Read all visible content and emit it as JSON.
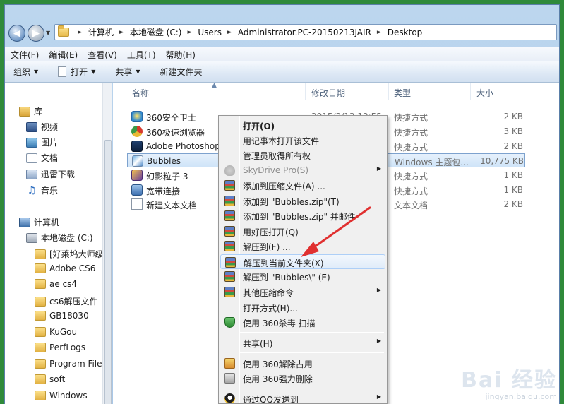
{
  "address": {
    "crumbs": [
      "计算机",
      "本地磁盘 (C:)",
      "Users",
      "Administrator.PC-20150213JAIR",
      "Desktop"
    ]
  },
  "menubar": [
    "文件(F)",
    "编辑(E)",
    "查看(V)",
    "工具(T)",
    "帮助(H)"
  ],
  "toolbar": {
    "organize": "组织",
    "open": "打开",
    "share": "共享",
    "new_folder": "新建文件夹"
  },
  "nav": {
    "libraries": "库",
    "videos": "视频",
    "pictures": "图片",
    "documents": "文档",
    "downloads": "迅雷下载",
    "music": "音乐",
    "computer": "计算机",
    "drive": "本地磁盘 (C:)",
    "folders": [
      "[好莱坞大师级",
      "Adobe CS6",
      "ae cs4",
      "cs6解压文件",
      "GB18030",
      "KuGou",
      "PerfLogs",
      "Program Files",
      "soft",
      "Windows"
    ]
  },
  "columns": {
    "name": "名称",
    "date": "修改日期",
    "type": "类型",
    "size": "大小"
  },
  "files": [
    {
      "name": "360安全卫士",
      "date": "2015/2/13 13:55",
      "type": "快捷方式",
      "size": "2 KB"
    },
    {
      "name": "360极速浏览器",
      "date": "",
      "type": "快捷方式",
      "size": "3 KB"
    },
    {
      "name": "Adobe Photoshop C",
      "date": "",
      "type": "快捷方式",
      "size": "2 KB"
    },
    {
      "name": "Bubbles",
      "date": "",
      "type": "Windows 主题包...",
      "size": "10,775 KB"
    },
    {
      "name": "幻影粒子 3",
      "date": "",
      "type": "快捷方式",
      "size": "1 KB"
    },
    {
      "name": "宽带连接",
      "date": "",
      "type": "快捷方式",
      "size": "1 KB"
    },
    {
      "name": "新建文本文档",
      "date": "",
      "type": "文本文档",
      "size": "2 KB"
    }
  ],
  "context_menu": {
    "open": "打开(O)",
    "open_notepad": "用记事本打开该文件",
    "take_ownership": "管理员取得所有权",
    "skydrive": "SkyDrive Pro(S)",
    "add_archive": "添加到压缩文件(A) ...",
    "add_zip": "添加到 \"Bubbles.zip\"(T)",
    "add_zip_mail": "添加到 \"Bubbles.zip\" 并邮件",
    "open_haozip": "用好压打开(Q)",
    "extract_to": "解压到(F) ...",
    "extract_here": "解压到当前文件夹(X)",
    "extract_folder": "解压到 \"Bubbles\\\" (E)",
    "more_commands": "其他压缩命令",
    "open_with": "打开方式(H)...",
    "scan_360": "使用 360杀毒 扫描",
    "share": "共享(H)",
    "unlock_360": "使用 360解除占用",
    "force_delete_360": "使用 360强力删除",
    "send_qq": "通过QQ发送到"
  },
  "watermark": {
    "logo": "Bai 经验",
    "sub": "jingyan.baidu.com"
  }
}
